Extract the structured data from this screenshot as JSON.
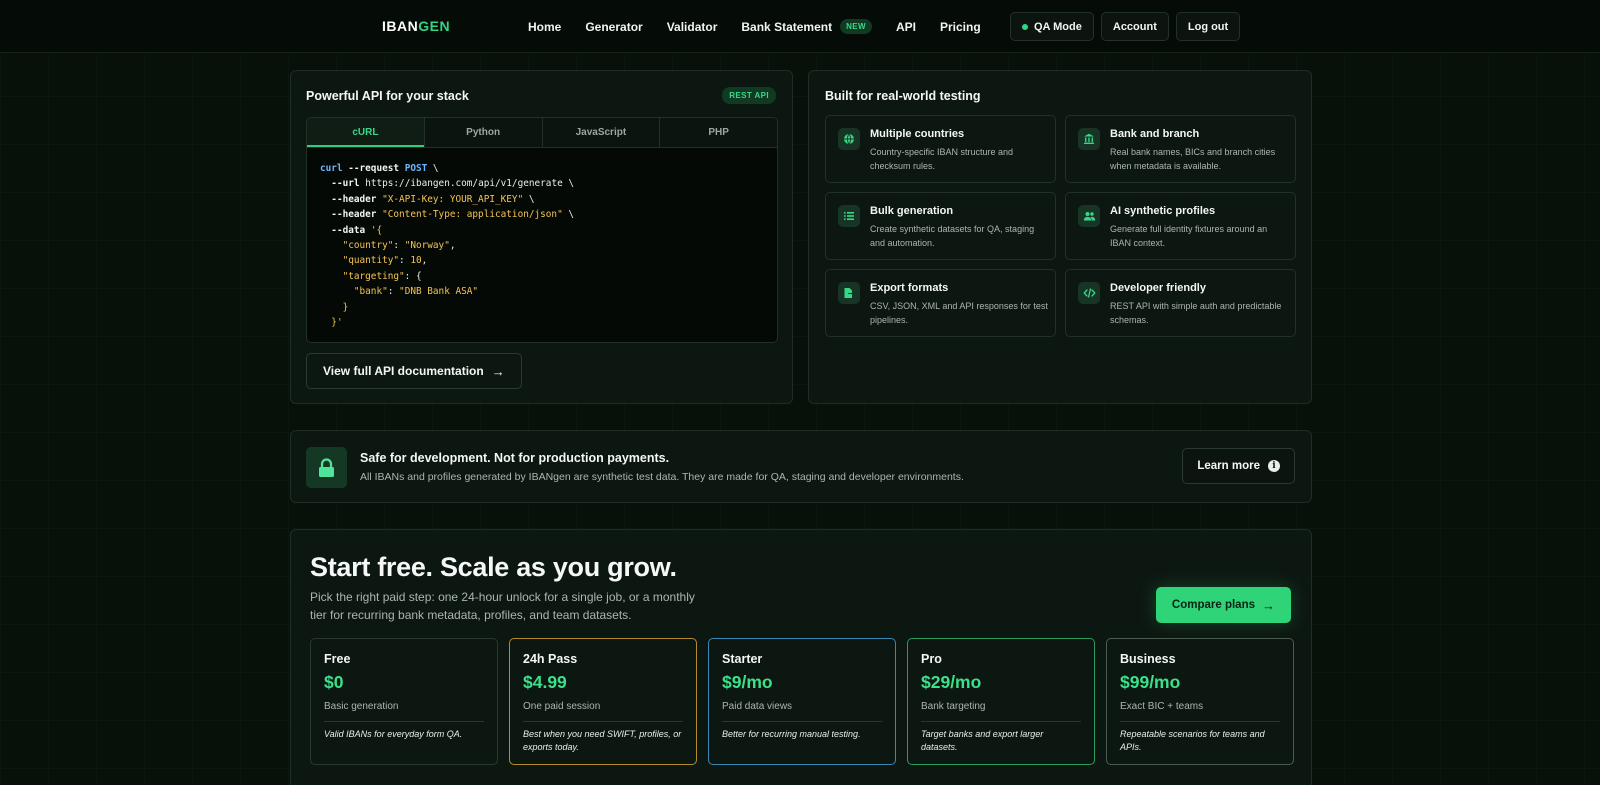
{
  "nav": {
    "logo_a": "IBAN",
    "logo_b": "GEN",
    "links": [
      "Home",
      "Generator",
      "Validator",
      "Bank Statement",
      "API",
      "Pricing"
    ],
    "new_badge": "NEW",
    "qa_mode": "QA Mode",
    "account": "Account",
    "logout": "Log out"
  },
  "api": {
    "title": "Powerful API for your stack",
    "badge": "REST API",
    "tabs": [
      "cURL",
      "Python",
      "JavaScript",
      "PHP"
    ],
    "active_tab": "cURL",
    "code": {
      "cmd": "curl",
      "l1_flag": "--request",
      "l1_method": "POST",
      "l2_flag": "--url",
      "l2_url": "https://ibangen.com/api/v1/generate",
      "l3_flag": "--header",
      "l3_str": "\"X-API-Key: YOUR_API_KEY\"",
      "l4_flag": "--header",
      "l4_str": "\"Content-Type: application/json\"",
      "l5_flag": "--data",
      "l5_open": "'{",
      "country_key": "\"country\"",
      "country_val": "\"Norway\"",
      "quantity_key": "\"quantity\"",
      "quantity_val": "10",
      "targeting_key": "\"targeting\"",
      "bank_key": "\"bank\"",
      "bank_val": "\"DNB Bank ASA\"",
      "close_inner": "}",
      "close_outer": "}'"
    },
    "doc_button": "View full API documentation"
  },
  "features": {
    "title": "Built for real-world testing",
    "items": [
      {
        "icon": "globe-icon",
        "title": "Multiple countries",
        "desc": "Country-specific IBAN structure and checksum rules."
      },
      {
        "icon": "bank-icon",
        "title": "Bank and branch",
        "desc": "Real bank names, BICs and branch cities when metadata is available."
      },
      {
        "icon": "list-icon",
        "title": "Bulk generation",
        "desc": "Create synthetic datasets for QA, staging and automation."
      },
      {
        "icon": "users-icon",
        "title": "AI synthetic profiles",
        "desc": "Generate full identity fixtures around an IBAN context."
      },
      {
        "icon": "file-export-icon",
        "title": "Export formats",
        "desc": "CSV, JSON, XML and API responses for test pipelines."
      },
      {
        "icon": "code-icon",
        "title": "Developer friendly",
        "desc": "REST API with simple auth and predictable schemas."
      }
    ]
  },
  "safe": {
    "title": "Safe for development. Not for production payments.",
    "desc": "All IBANs and profiles generated by IBANgen are synthetic test data. They are made for QA, staging and developer environments.",
    "button": "Learn more"
  },
  "pricing": {
    "title": "Start free. Scale as you grow.",
    "subtitle": "Pick the right paid step: one 24-hour unlock for a single job, or a monthly tier for recurring bank metadata, profiles, and team datasets.",
    "compare_button": "Compare plans",
    "plans": [
      {
        "name": "Free",
        "price": "$0",
        "desc": "Basic generation",
        "note": "Valid IBANs for everyday form QA."
      },
      {
        "name": "24h Pass",
        "price": "$4.99",
        "desc": "One paid session",
        "note": "Best when you need SWIFT, profiles, or exports today."
      },
      {
        "name": "Starter",
        "price": "$9/mo",
        "desc": "Paid data views",
        "note": "Better for recurring manual testing."
      },
      {
        "name": "Pro",
        "price": "$29/mo",
        "desc": "Bank targeting",
        "note": "Target banks and export larger datasets."
      },
      {
        "name": "Business",
        "price": "$99/mo",
        "desc": "Exact BIC + teams",
        "note": "Repeatable scenarios for teams and APIs."
      }
    ]
  },
  "colors": {
    "accent": "#2ed477",
    "background": "#071109",
    "pass_border": "#b38a2c",
    "starter_border": "#3b87b3",
    "pro_border": "#2c9c5a"
  }
}
